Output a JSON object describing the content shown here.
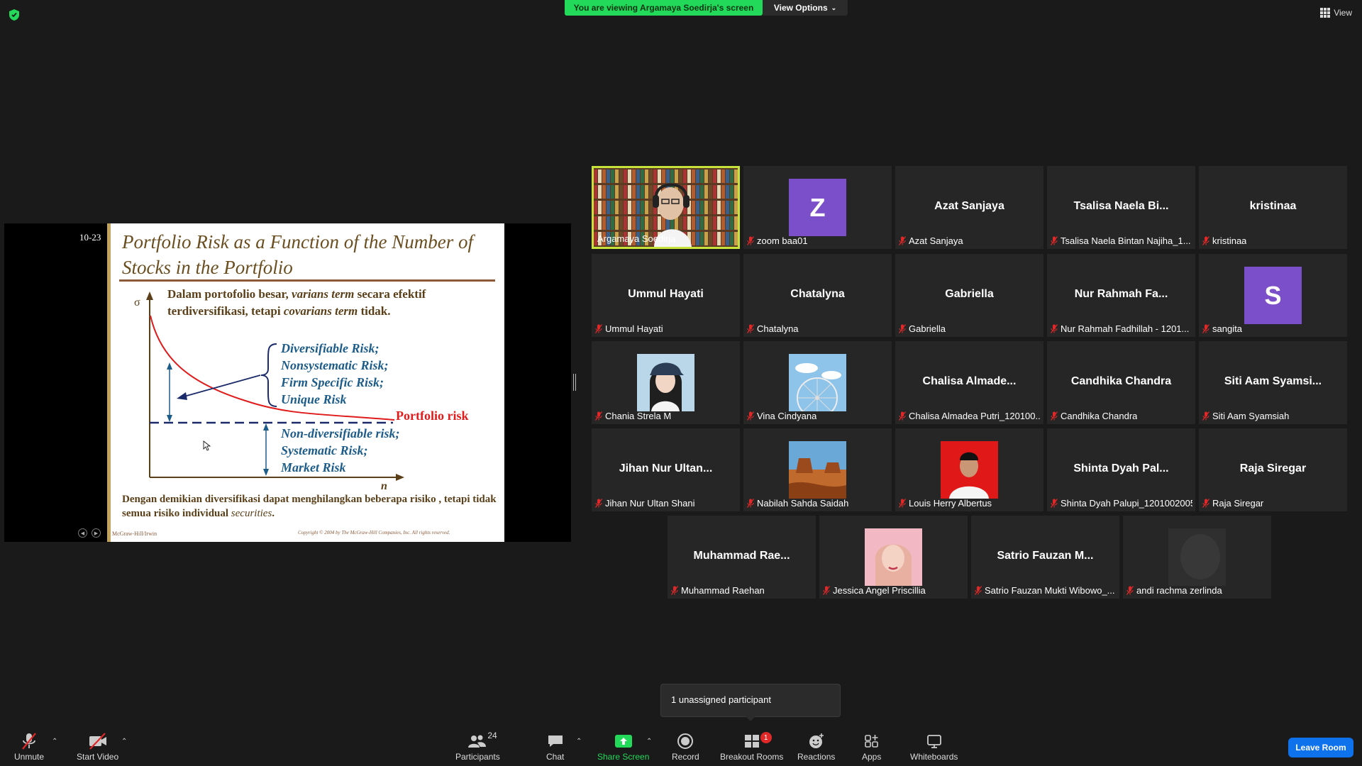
{
  "top": {
    "viewing_banner": "You are viewing Argamaya Soedirja's screen",
    "view_options": "View Options",
    "view": "View"
  },
  "slide": {
    "number": "10-23",
    "title": "Portfolio Risk as a Function of the Number of Stocks in the Portfolio",
    "intro_part1": "Dalam portofolio besar, ",
    "intro_em1": "varians term",
    "intro_part2": " secara efektif terdiversifikasi, tetapi ",
    "intro_em2": "covarians term",
    "intro_part3": " tidak.",
    "sigma": "σ",
    "n_axis": "n",
    "diversifiable": [
      "Diversifiable Risk;",
      "Nonsystematic Risk;",
      "Firm Specific Risk;",
      "Unique Risk"
    ],
    "portfolio_risk": "Portfolio risk",
    "non_diversifiable": [
      "Non-diversifiable risk;",
      "Systematic Risk;",
      "Market Risk"
    ],
    "conclusion_part1": "Dengan demikian diversifikasi dapat menghilangkan beberapa risiko , tetapi tidak semua risiko individual ",
    "conclusion_em": "securities",
    "conclusion_part2": ".",
    "footer_left": "McGraw-Hill/Irwin",
    "footer_right": "Copyright © 2004 by The McGraw-Hill Companies, Inc.  All rights reserved."
  },
  "participants": [
    {
      "big": "",
      "label": "Argamaya Soedirja",
      "muted": false,
      "kind": "video-books"
    },
    {
      "big": "Z",
      "label": "zoom baa01",
      "muted": true,
      "kind": "letter",
      "color": "#7b4fc9"
    },
    {
      "big": "Azat Sanjaya",
      "label": "Azat Sanjaya",
      "muted": true,
      "kind": "name"
    },
    {
      "big": "Tsalisa Naela Bi...",
      "label": "Tsalisa Naela Bintan Najiha_1...",
      "muted": true,
      "kind": "name"
    },
    {
      "big": "kristinaa",
      "label": "kristinaa",
      "muted": true,
      "kind": "name"
    },
    {
      "big": "Ummul Hayati",
      "label": "Ummul Hayati",
      "muted": true,
      "kind": "name"
    },
    {
      "big": "Chatalyna",
      "label": "Chatalyna",
      "muted": true,
      "kind": "name"
    },
    {
      "big": "Gabriella",
      "label": "Gabriella",
      "muted": true,
      "kind": "name"
    },
    {
      "big": "Nur Rahmah Fa...",
      "label": "Nur Rahmah Fadhillah - 1201...",
      "muted": true,
      "kind": "name"
    },
    {
      "big": "S",
      "label": "sangita",
      "muted": true,
      "kind": "letter",
      "color": "#7b4fc9"
    },
    {
      "big": "",
      "label": "Chania Strela M",
      "muted": true,
      "kind": "photo-girl"
    },
    {
      "big": "",
      "label": "Vina Cindyana",
      "muted": true,
      "kind": "photo-wheel"
    },
    {
      "big": "Chalisa Almade...",
      "label": "Chalisa Almadea Putri_120100...",
      "muted": true,
      "kind": "name"
    },
    {
      "big": "Candhika Chandra",
      "label": "Candhika Chandra",
      "muted": true,
      "kind": "name"
    },
    {
      "big": "Siti Aam Syamsi...",
      "label": "Siti Aam Syamsiah",
      "muted": true,
      "kind": "name"
    },
    {
      "big": "Jihan Nur Ultan...",
      "label": "Jihan Nur Ultan Shani",
      "muted": true,
      "kind": "name"
    },
    {
      "big": "",
      "label": "Nabilah Sahda Saidah",
      "muted": true,
      "kind": "photo-desert"
    },
    {
      "big": "",
      "label": "Louis Herry Albertus",
      "muted": true,
      "kind": "photo-red"
    },
    {
      "big": "Shinta Dyah Pal...",
      "label": "Shinta Dyah Palupi_1201002005",
      "muted": true,
      "kind": "name"
    },
    {
      "big": "Raja Siregar",
      "label": "Raja Siregar",
      "muted": true,
      "kind": "name"
    },
    {
      "big": "Muhammad Rae...",
      "label": "Muhammad Raehan",
      "muted": true,
      "kind": "name"
    },
    {
      "big": "",
      "label": "Jessica Angel Priscillia",
      "muted": true,
      "kind": "photo-pink"
    },
    {
      "big": "Satrio Fauzan M...",
      "label": "Satrio Fauzan Mukti Wibowo_...",
      "muted": true,
      "kind": "name"
    },
    {
      "big": "",
      "label": "andi rachma zerlinda",
      "muted": true,
      "kind": "photo-dark"
    }
  ],
  "toast": "1 unassigned participant",
  "toolbar": {
    "unmute": "Unmute",
    "start_video": "Start Video",
    "participants": "Participants",
    "participants_count": "24",
    "chat": "Chat",
    "share_screen": "Share Screen",
    "record": "Record",
    "breakout_rooms": "Breakout Rooms",
    "breakout_badge": "1",
    "reactions": "Reactions",
    "apps": "Apps",
    "whiteboards": "Whiteboards",
    "leave_room": "Leave Room"
  },
  "colors": {
    "banner_green": "#23d959",
    "active_speaker": "#c7e33b",
    "leave_blue": "#0e72ed",
    "avatar_purple": "#7b4fc9",
    "portfolio_curve": "#e01b1b",
    "risk_text_blue": "#1c5c8a"
  }
}
